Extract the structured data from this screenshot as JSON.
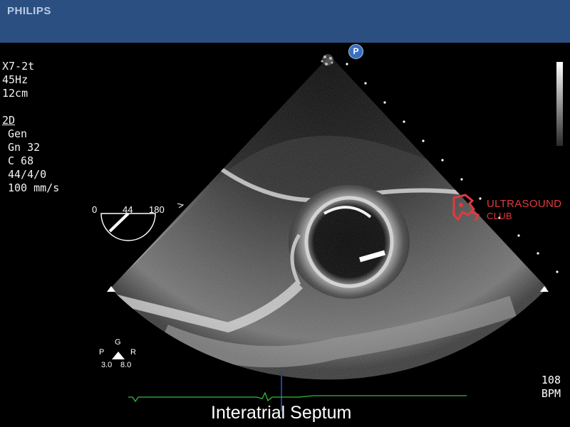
{
  "header": {
    "brand": "PHILIPS"
  },
  "params": {
    "transducer": "X7-2t",
    "frame_rate": "45Hz",
    "depth": "12cm",
    "mode": "2D",
    "preset": "Gen",
    "gain": "Gn 32",
    "compression": "C 68",
    "persistence": "44/4/0",
    "sweep": "100 mm/s"
  },
  "angle": {
    "min": "0",
    "current": "44",
    "max": "180",
    "value_deg": 44
  },
  "orientation": {
    "g": "G",
    "p": "P",
    "r": "R",
    "left_value": "3.0",
    "right_value": "8.0"
  },
  "probe_marker": "P",
  "watermark": {
    "line1": "ULTRASOUND",
    "line2": "CLUB"
  },
  "heart_rate": {
    "value": "108",
    "unit": "BPM"
  },
  "caption": "Interatrial Septum",
  "colors": {
    "header": "#2b4f80",
    "ecg": "#2fbf3a",
    "watermark": "#e03a3e",
    "marker": "#3a6fc0"
  }
}
